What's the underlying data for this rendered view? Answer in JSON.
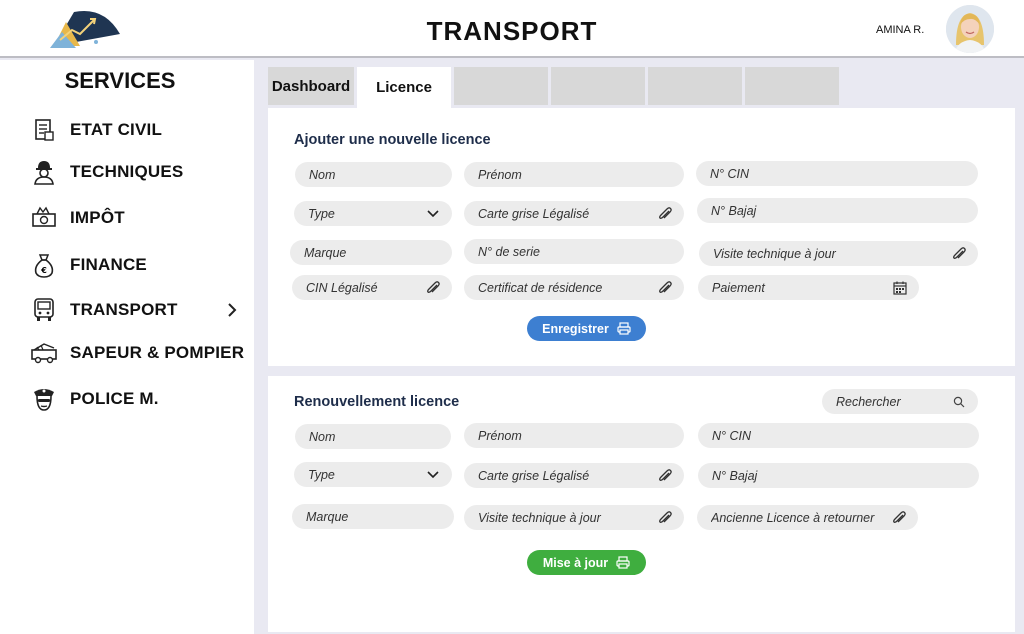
{
  "header": {
    "title": "TRANSPORT",
    "user_name": "AMINA R."
  },
  "sidebar": {
    "title": "SERVICES",
    "items": [
      {
        "label": "ETAT CIVIL",
        "icon": "document-icon"
      },
      {
        "label": "TECHNIQUES",
        "icon": "worker-icon"
      },
      {
        "label": "IMPÔT",
        "icon": "tax-money-icon"
      },
      {
        "label": "FINANCE",
        "icon": "money-bag-icon"
      },
      {
        "label": "TRANSPORT",
        "icon": "bus-icon"
      },
      {
        "label": "SAPEUR & POMPIER",
        "icon": "fire-truck-icon"
      },
      {
        "label": "POLICE M.",
        "icon": "police-icon"
      }
    ]
  },
  "tabs": [
    {
      "label": "Dashboard"
    },
    {
      "label": "Licence"
    },
    {
      "label": ""
    },
    {
      "label": ""
    },
    {
      "label": ""
    },
    {
      "label": ""
    }
  ],
  "new_licence": {
    "title": "Ajouter une nouvelle licence",
    "nom": "Nom",
    "prenom": "Prénom",
    "cin": "N° CIN",
    "type": "Type",
    "carte_grise": "Carte grise Légalisé",
    "bajaj": "N° Bajaj",
    "marque": "Marque",
    "serie": "N° de serie",
    "visite": "Visite technique à jour",
    "cin_legalise": "CIN Légalisé",
    "residence": "Certificat de résidence",
    "paiement": "Paiement",
    "submit": "Enregistrer"
  },
  "renew": {
    "title": "Renouvellement licence",
    "search": "Rechercher",
    "nom": "Nom",
    "prenom": "Prénom",
    "cin": "N° CIN",
    "type": "Type",
    "carte_grise": "Carte grise Légalisé",
    "bajaj": "N° Bajaj",
    "marque": "Marque",
    "visite": "Visite technique à jour",
    "ancienne": "Ancienne Licence à retourner",
    "submit": "Mise à jour"
  },
  "colors": {
    "primary_button": "#3d7fd1",
    "update_button": "#3fae3f",
    "title_text": "#1e2d4a"
  }
}
